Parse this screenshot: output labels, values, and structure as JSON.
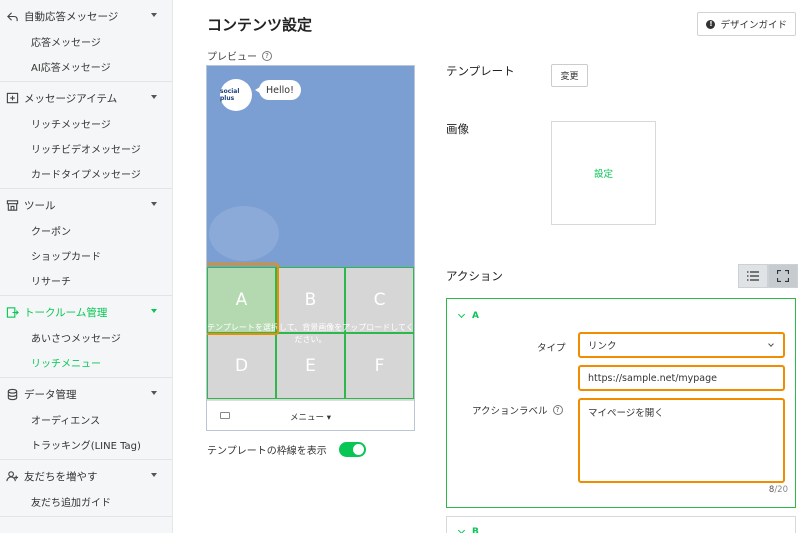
{
  "sidebar": {
    "groups": [
      {
        "label": "自動応答メッセージ",
        "items": [
          "応答メッセージ",
          "AI応答メッセージ"
        ]
      },
      {
        "label": "メッセージアイテム",
        "items": [
          "リッチメッセージ",
          "リッチビデオメッセージ",
          "カードタイプメッセージ"
        ]
      },
      {
        "label": "ツール",
        "items": [
          "クーポン",
          "ショップカード",
          "リサーチ"
        ]
      },
      {
        "label": "トークルーム管理",
        "items": [
          "あいさつメッセージ",
          "リッチメニュー"
        ]
      },
      {
        "label": "データ管理",
        "items": [
          "オーディエンス",
          "トラッキング(LINE Tag)"
        ]
      },
      {
        "label": "友だちを増やす",
        "items": [
          "友だち追加ガイド"
        ]
      }
    ]
  },
  "page": {
    "title": "コンテンツ設定",
    "guide_button": "デザインガイド"
  },
  "preview": {
    "label": "プレビュー",
    "help": "?",
    "logo_text": "social plus",
    "bubble": "Hello!",
    "cells": [
      "A",
      "B",
      "C",
      "D",
      "E",
      "F"
    ],
    "hint": "テンプレートを選択して、背景画像をアップロードしてください。",
    "menu_label": "メニュー ▾"
  },
  "toggle": {
    "label": "テンプレートの枠線を表示",
    "on": true
  },
  "template": {
    "label": "テンプレート",
    "change_button": "変更"
  },
  "image": {
    "label": "画像",
    "set_button": "設定"
  },
  "action": {
    "label": "アクション",
    "section_a": "A",
    "section_b": "B",
    "type_label": "タイプ",
    "type_value": "リンク",
    "url_value": "https://sample.net/mypage",
    "action_label_label": "アクションラベル",
    "action_label_help": "?",
    "action_label_value": "マイページを開く",
    "counter_current": "8",
    "counter_max": "/20"
  },
  "colors": {
    "accent": "#06c755",
    "highlight": "#f08c00",
    "preview_bg": "#7b9fd3"
  }
}
